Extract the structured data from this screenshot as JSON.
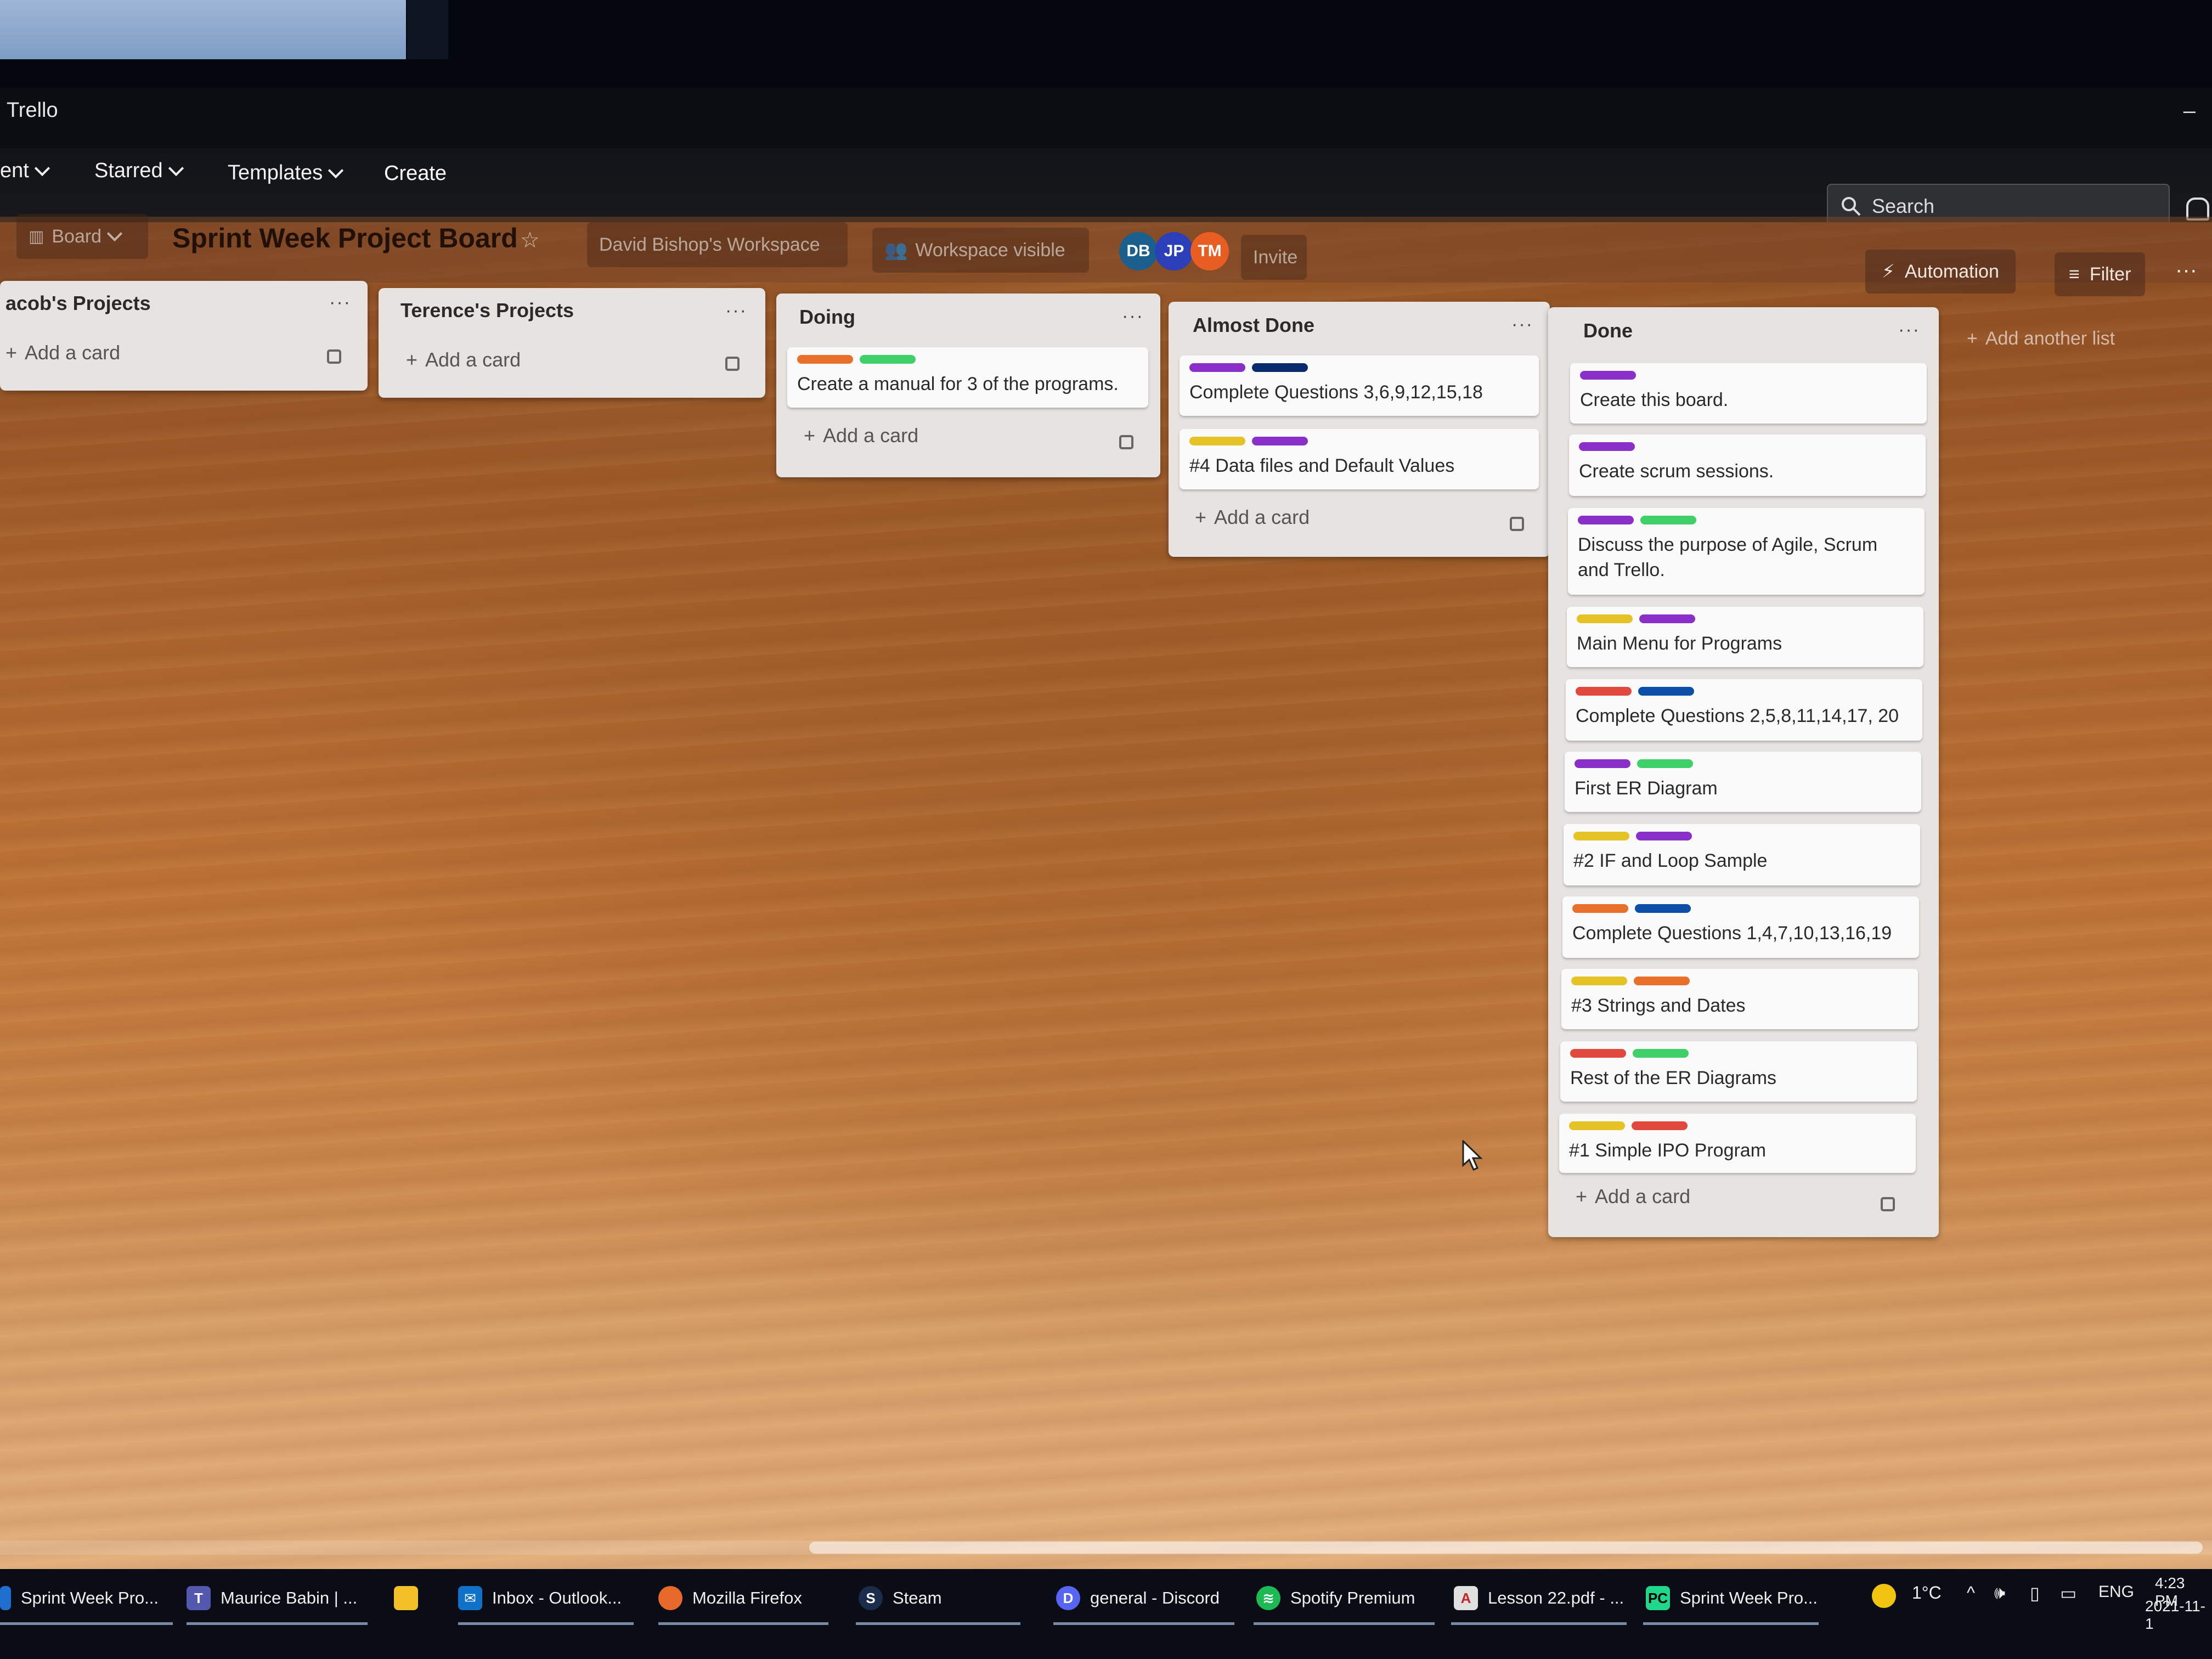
{
  "window": {
    "title": "Trello"
  },
  "nav": {
    "items": [
      "ent",
      "Starred",
      "Templates"
    ],
    "create_label": "Create",
    "search_placeholder": "Search"
  },
  "board": {
    "view_label": "Board",
    "title": "Sprint Week Project Board",
    "workspace": "David Bishop's Workspace",
    "visibility": "Workspace visible",
    "members": [
      {
        "initials": "DB",
        "color": "#1b5f8c"
      },
      {
        "initials": "JP",
        "color": "#2a3fb8"
      },
      {
        "initials": "TM",
        "color": "#e85d22"
      }
    ],
    "invite_label": "Invite",
    "automation_label": "Automation",
    "filter_label": "Filter",
    "add_list_label": "Add another list"
  },
  "label_colors": {
    "purple": "#8a2fc7",
    "navy": "#0a2a6e",
    "blue": "#0b4fa8",
    "green": "#3fd06a",
    "orange": "#e8702a",
    "yellow": "#e5c326",
    "red": "#e0493c"
  },
  "lists": [
    {
      "title": "acob's Projects",
      "add_label": "Add a card",
      "cards": []
    },
    {
      "title": "Terence's Projects",
      "add_label": "Add a card",
      "cards": []
    },
    {
      "title": "Doing",
      "add_label": "Add a card",
      "cards": [
        {
          "text": "Create a manual for 3 of the programs.",
          "labels": [
            "orange",
            "green"
          ]
        }
      ]
    },
    {
      "title": "Almost Done",
      "add_label": "Add a card",
      "cards": [
        {
          "text": "Complete Questions 3,6,9,12,15,18",
          "labels": [
            "purple",
            "navy"
          ]
        },
        {
          "text": "#4 Data files and Default Values",
          "labels": [
            "yellow",
            "purple"
          ]
        }
      ]
    },
    {
      "title": "Done",
      "add_label": "Add a card",
      "cards": [
        {
          "text": "Create this board.",
          "labels": [
            "purple"
          ]
        },
        {
          "text": "Create scrum sessions.",
          "labels": [
            "purple"
          ]
        },
        {
          "text": "Discuss the purpose of Agile, Scrum and Trello.",
          "labels": [
            "purple",
            "green"
          ]
        },
        {
          "text": "Main Menu for Programs",
          "labels": [
            "yellow",
            "purple"
          ]
        },
        {
          "text": "Complete Questions 2,5,8,11,14,17, 20",
          "labels": [
            "red",
            "blue"
          ]
        },
        {
          "text": "First ER Diagram",
          "labels": [
            "purple",
            "green"
          ]
        },
        {
          "text": "#2 IF and Loop Sample",
          "labels": [
            "yellow",
            "purple"
          ]
        },
        {
          "text": "Complete Questions 1,4,7,10,13,16,19",
          "labels": [
            "orange",
            "blue"
          ]
        },
        {
          "text": "#3 Strings and Dates",
          "labels": [
            "yellow",
            "orange"
          ]
        },
        {
          "text": "Rest of the ER Diagrams",
          "labels": [
            "red",
            "green"
          ]
        },
        {
          "text": "#1 Simple IPO Program",
          "labels": [
            "yellow",
            "red"
          ]
        }
      ]
    }
  ],
  "taskbar": {
    "apps": [
      {
        "label": "Sprint Week Pro...",
        "icon": "edge-icon"
      },
      {
        "label": "Maurice Babin | ...",
        "icon": "teams-icon"
      },
      {
        "label": "",
        "icon": "file-explorer-icon"
      },
      {
        "label": "Inbox - Outlook...",
        "icon": "outlook-icon"
      },
      {
        "label": "Mozilla Firefox",
        "icon": "firefox-icon"
      },
      {
        "label": "Steam",
        "icon": "steam-icon"
      },
      {
        "label": "general - Discord",
        "icon": "discord-icon"
      },
      {
        "label": "Spotify Premium",
        "icon": "spotify-icon"
      },
      {
        "label": "Lesson 22.pdf - ...",
        "icon": "pdf-icon"
      },
      {
        "label": "Sprint Week Pro...",
        "icon": "pycharm-icon"
      }
    ],
    "weather": "1°C",
    "language": "ENG",
    "time": "4:23 PM",
    "date": "2021-11-1"
  }
}
